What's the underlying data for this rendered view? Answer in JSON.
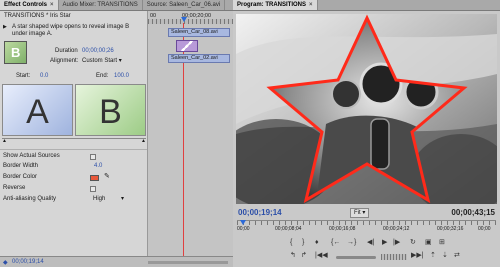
{
  "effect_controls": {
    "tabs": [
      {
        "label": "Effect Controls",
        "active": true
      },
      {
        "label": "Audio Mixer: TRANSITIONS",
        "active": false
      },
      {
        "label": "Source: Saleen_Car_06.avi",
        "active": false
      }
    ],
    "header_title": "TRANSITIONS * Iris Star",
    "timecode_header": "00;00;20;00",
    "description": "A star shaped wipe opens to reveal image B under image A.",
    "thumbnail_letter": "B",
    "duration_label": "Duration",
    "duration_value": "00;00;00;26",
    "alignment_label": "Alignment:",
    "alignment_value": "Custom Start",
    "start_label": "Start:",
    "start_value": "0.0",
    "end_label": "End:",
    "end_value": "100.0",
    "preview_a": "A",
    "preview_b": "B",
    "show_actual_sources": "Show Actual Sources",
    "border_width_label": "Border Width",
    "border_width_value": "4.0",
    "border_color_label": "Border Color",
    "border_color": "#e8583a",
    "reverse_label": "Reverse",
    "antialias_label": "Anti-aliasing Quality",
    "antialias_value": "High",
    "footer_timecode": "00;00;19;14",
    "clips": [
      "Saleen_Car_08.avi",
      "Saleen_Car_02.avi"
    ]
  },
  "program": {
    "tab_label": "Program: TRANSITIONS",
    "current_time": "00;00;19;14",
    "fit_label": "Fit",
    "duration": "00;00;43;15",
    "ruler_labels": [
      "00;00",
      "00;00;08;04",
      "00;00;16;08",
      "00;00;24;12",
      "00;00;32;16",
      "00;00"
    ],
    "transport_buttons": [
      "mark-in",
      "mark-out",
      "set-in",
      "set-out",
      "go-to-in",
      "step-back",
      "play",
      "step-forward",
      "go-to-out",
      "loop",
      "safe-margins",
      "output",
      "lift",
      "extract",
      "trim"
    ]
  },
  "colors": {
    "accent_blue": "#2c4fa8",
    "border_color_swatch": "#e8583a",
    "star_outline": "#ff2a1a"
  }
}
